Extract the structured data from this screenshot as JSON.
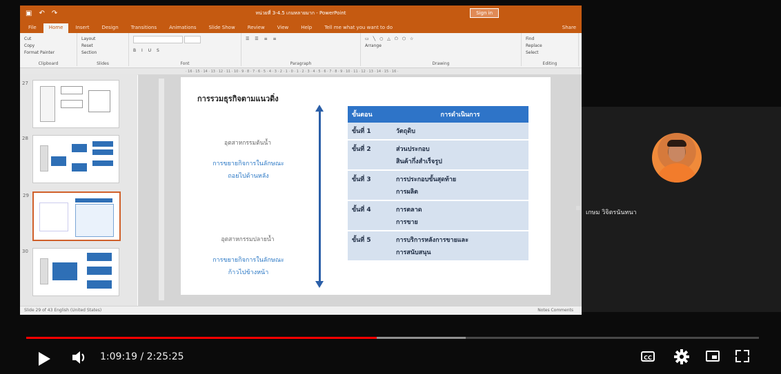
{
  "presentation": {
    "doc_title": "หน่วยที่ 3-4.5 เกมหลายมาก - PowerPoint",
    "sign_in": "Sign in",
    "tabs": [
      "File",
      "Home",
      "Insert",
      "Design",
      "Transitions",
      "Animations",
      "Slide Show",
      "Review",
      "View",
      "Help",
      "Tell me what you want to do"
    ],
    "share_label": "Share",
    "ribbon": {
      "clipboard": {
        "label": "Clipboard",
        "items": [
          "Cut",
          "Copy",
          "Format Painter",
          "Paste"
        ]
      },
      "slides": {
        "label": "Slides",
        "items": [
          "Layout",
          "Reset",
          "Section",
          "New Slide"
        ]
      },
      "font": {
        "label": "Font"
      },
      "paragraph": {
        "label": "Paragraph"
      },
      "drawing": {
        "label": "Drawing",
        "items": [
          "Arrange",
          "Quick Styles",
          "Shape Fill",
          "Shape Outline",
          "Shape Effects"
        ]
      },
      "editing": {
        "label": "Editing",
        "items": [
          "Find",
          "Replace",
          "Select"
        ]
      }
    },
    "ruler": "· 16 · 15 · 14 · 13 · 12 · 11 · 10 · 9 · 8 · 7 · 6 · 5 · 4 · 3 · 2 · 1 · 0 · 1 · 2 · 3 · 4 · 5 · 6 · 7 · 8 · 9 · 10 · 11 · 12 · 13 · 14 · 15 · 16 ·",
    "thumbnails": [
      {
        "num": "27",
        "selected": false
      },
      {
        "num": "28",
        "selected": false
      },
      {
        "num": "29",
        "selected": true
      },
      {
        "num": "30",
        "selected": false
      }
    ],
    "slide": {
      "title": "การรวมธุรกิจตามแนวดิ่ง",
      "upstream_label": "อุตสาหกรรมต้นน้ำ",
      "upstream_desc_1": "การขยายกิจการในลักษณะ",
      "upstream_desc_2": "ถอยไปด้านหลัง",
      "downstream_label": "อุตสาหกรรมปลายน้ำ",
      "downstream_desc_1": "การขยายกิจการในลักษณะ",
      "downstream_desc_2": "ก้าวไปข้างหน้า",
      "table": {
        "header_step": "ขั้นตอน",
        "header_op": "การดำเนินการ",
        "rows": [
          {
            "step": "ขั้นที่ 1",
            "line1": "วัตถุดิบ",
            "line2": ""
          },
          {
            "step": "ขั้นที่ 2",
            "line1": "ส่วนประกอบ",
            "line2": "สินค้ากึ่งสำเร็จรูป"
          },
          {
            "step": "ขั้นที่ 3",
            "line1": "การประกอบขั้นสุดท้าย",
            "line2": "การผลิต"
          },
          {
            "step": "ขั้นที่ 4",
            "line1": "การตลาด",
            "line2": "การขาย"
          },
          {
            "step": "ขั้นที่ 5",
            "line1": "การบริการหลังการขายและ",
            "line2": "การสนับสนุน"
          }
        ]
      }
    },
    "status": {
      "left": "Slide 29 of 43    English (United States)",
      "right": "Notes    Comments"
    }
  },
  "participant": {
    "name": "เกษม วิจิตรนันทนา"
  },
  "player": {
    "time_current": "1:09:19",
    "time_total": "2:25:25",
    "progress_fraction": 0.478,
    "cc_label": "CC"
  }
}
